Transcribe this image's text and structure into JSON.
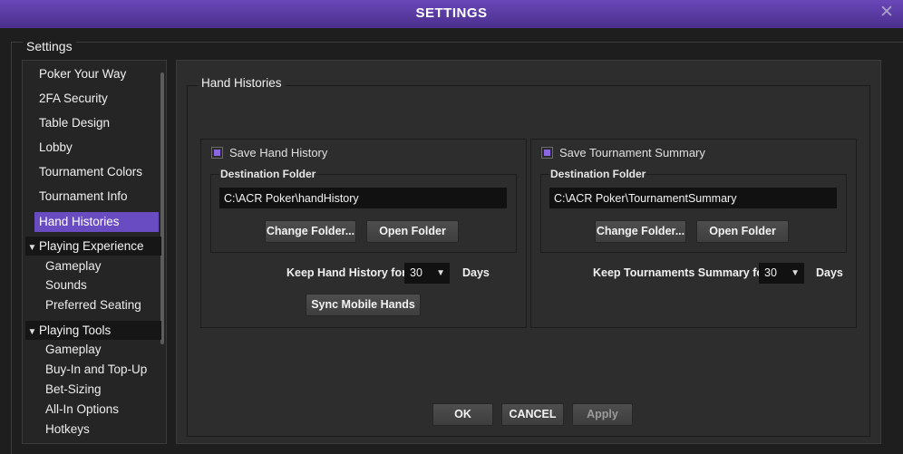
{
  "window": {
    "title": "SETTINGS",
    "close_glyph": "✕"
  },
  "frame": {
    "label": "Settings"
  },
  "sidebar": {
    "items": [
      {
        "label": "Poker Your Way"
      },
      {
        "label": "2FA Security"
      },
      {
        "label": "Table Design"
      },
      {
        "label": "Lobby"
      },
      {
        "label": "Tournament Colors"
      },
      {
        "label": "Tournament Info"
      },
      {
        "label": "Hand Histories",
        "active": true
      }
    ],
    "groups": [
      {
        "label": "Playing Experience",
        "chevron": "⌄",
        "children": [
          "Gameplay",
          "Sounds",
          "Preferred Seating"
        ]
      },
      {
        "label": "Playing Tools",
        "chevron": "⌄",
        "children": [
          "Gameplay",
          "Buy-In and Top-Up",
          "Bet-Sizing",
          "All-In Options",
          "Hotkeys"
        ]
      }
    ]
  },
  "main": {
    "group_label": "Hand Histories",
    "hand_history": {
      "checkbox_label": "Save Hand History",
      "checked": true,
      "destination_label": "Destination Folder",
      "path": "C:\\ACR Poker\\handHistory",
      "change_button": "Change Folder...",
      "open_button": "Open Folder",
      "keep_label": "Keep Hand History for :",
      "keep_value": "30",
      "days_label": "Days",
      "sync_button": "Sync Mobile Hands"
    },
    "tournament_summary": {
      "checkbox_label": "Save Tournament Summary",
      "checked": true,
      "destination_label": "Destination Folder",
      "path": "C:\\ACR Poker\\TournamentSummary",
      "change_button": "Change Folder...",
      "open_button": "Open Folder",
      "keep_label": "Keep Tournaments Summary for :",
      "keep_value": "30",
      "days_label": "Days"
    }
  },
  "footer": {
    "ok": "OK",
    "cancel": "CANCEL",
    "apply": "Apply"
  },
  "colors": {
    "accent": "#6a4cc2",
    "titlebar": "#5a3aa8",
    "checkbox_fill": "#8a67e0"
  }
}
